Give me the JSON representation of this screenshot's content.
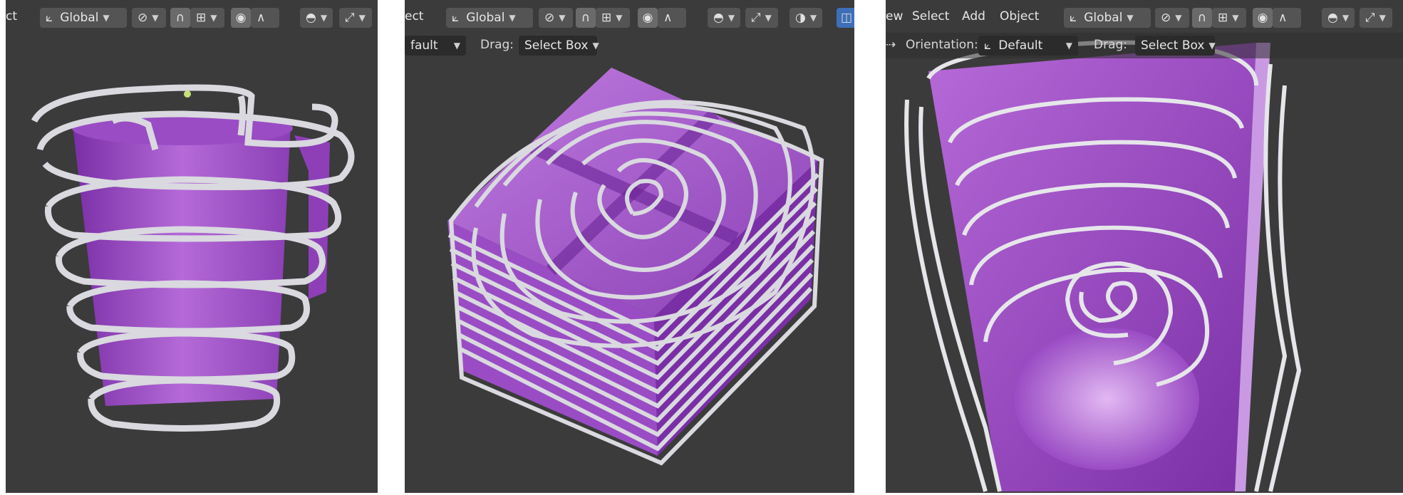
{
  "panels": [
    {
      "menu_fragment": "ct",
      "orientation": "Global",
      "toolbar_icons": [
        "transform-orientation-icon",
        "link-icon",
        "snap-magnet-icon",
        "snap-increment-icon",
        "proportional-edit-icon",
        "falloff-icon",
        "visibility-icon",
        "gizmo-icon"
      ]
    },
    {
      "menu_fragment": "ect",
      "orientation": "Global",
      "orientation_row_fragment": "fault",
      "drag_label": "Drag:",
      "drag_value": "Select Box",
      "toolbar_icons": [
        "transform-orientation-icon",
        "link-icon",
        "snap-magnet-icon",
        "snap-increment-icon",
        "proportional-edit-icon",
        "falloff-icon",
        "visibility-icon",
        "gizmo-icon",
        "overlay-icon",
        "xray-icon"
      ]
    },
    {
      "menu_fragment": "ew",
      "menu_items": [
        "Select",
        "Add",
        "Object"
      ],
      "orientation": "Global",
      "orientation_label": "Orientation:",
      "orientation_value": "Default",
      "drag_label": "Drag:",
      "drag_value": "Select Box",
      "toolbar_icons": [
        "transform-orientation-icon",
        "link-icon",
        "snap-magnet-icon",
        "snap-increment-icon",
        "proportional-edit-icon",
        "falloff-icon",
        "visibility-icon",
        "gizmo-icon"
      ]
    }
  ],
  "colors": {
    "viewport_bg": "#3b3b3b",
    "object_purple": "#a256c9",
    "curve_white": "#d9d9df"
  }
}
